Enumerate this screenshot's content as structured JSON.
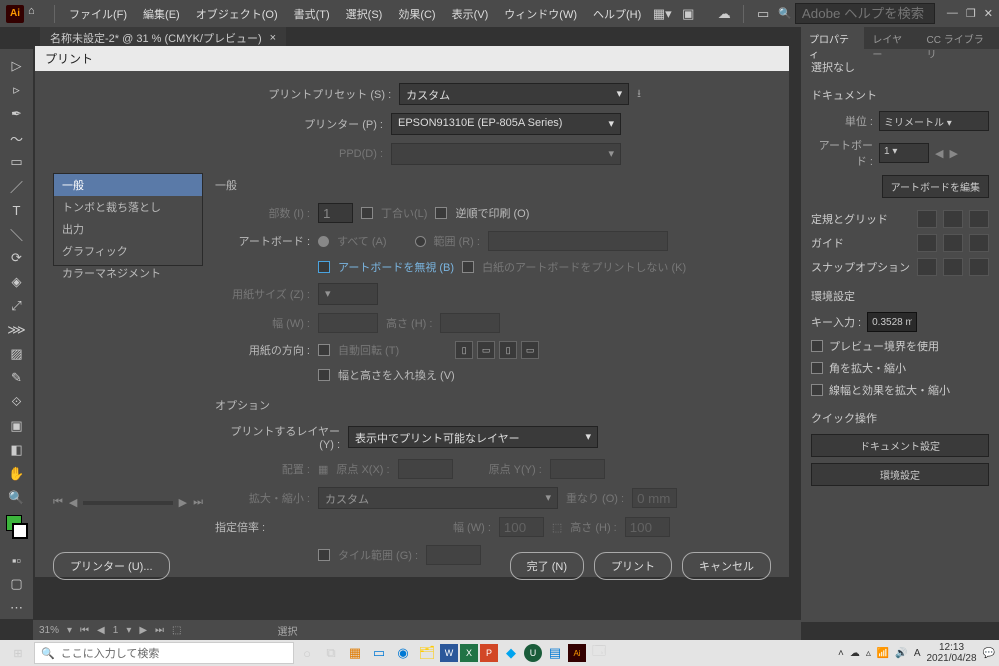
{
  "app": {
    "logo_text": "Ai",
    "menus": [
      "ファイル(F)",
      "編集(E)",
      "オブジェクト(O)",
      "書式(T)",
      "選択(S)",
      "効果(C)",
      "表示(V)",
      "ウィンドウ(W)",
      "ヘルプ(H)"
    ],
    "search_placeholder": "Adobe ヘルプを検索"
  },
  "tab": {
    "label": "名称未設定-2* @ 31 % (CMYK/プレビュー)",
    "close": "×"
  },
  "dialog": {
    "title": "プリント",
    "preset_label": "プリントプリセット (S) :",
    "preset_value": "カスタム",
    "printer_label": "プリンター (P) :",
    "printer_value": "EPSON91310E (EP-805A Series)",
    "ppd_label": "PPD(D) :",
    "categories": [
      "一般",
      "トンボと裁ち落とし",
      "出力",
      "グラフィック",
      "カラーマネジメント"
    ],
    "section": "一般",
    "copies_label": "部数 (I) :",
    "copies_value": "1",
    "collate_label": "丁合い(L)",
    "reverse_label": "逆順で印刷 (O)",
    "artboard_label": "アートボード :",
    "all_label": "すべて (A)",
    "range_label": "範囲 (R) :",
    "ignore_artboard": "アートボードを無視 (B)",
    "skip_blank": "白紙のアートボードをプリントしない (K)",
    "media_size_label": "用紙サイズ (Z) :",
    "width_label": "幅 (W) :",
    "height_label": "高さ (H) :",
    "orientation_label": "用紙の方向 :",
    "auto_rotate": "自動回転 (T)",
    "transverse": "幅と高さを入れ換え (V)",
    "options_title": "オプション",
    "layers_label": "プリントするレイヤー (Y) :",
    "layers_value": "表示中でプリント可能なレイヤー",
    "placement_label": "配置 :",
    "origin_x": "原点 X(X) :",
    "origin_y": "原点 Y(Y) :",
    "scale_label": "拡大・縮小 :",
    "scale_value": "カスタム",
    "overlap_label": "重なり (O) :",
    "overlap_value": "0 mm",
    "custom_scale": "指定倍率 :",
    "scale_w": "幅 (W) :",
    "scale_w_val": "100",
    "scale_h": "高さ (H) :",
    "scale_h_val": "100",
    "tile_range": "タイル範囲 (G) :",
    "printer_btn": "プリンター (U)...",
    "done_btn": "完了 (N)",
    "print_btn": "プリント",
    "cancel_btn": "キャンセル"
  },
  "props": {
    "tabs": [
      "プロパティ",
      "レイヤー",
      "CC ライブラリ"
    ],
    "no_selection": "選択なし",
    "doc_hdr": "ドキュメント",
    "units_label": "単位 :",
    "units_value": "ミリメートル",
    "artboard_label": "アートボード :",
    "artboard_value": "1",
    "edit_artboard": "アートボードを編集",
    "ruler_grid": "定規とグリッド",
    "guides": "ガイド",
    "snap_options": "スナップオプション",
    "prefs_hdr": "環境設定",
    "key_input": "キー入力 :",
    "key_value": "0.3528 m",
    "use_preview": "プレビュー境界を使用",
    "scale_corners": "角を拡大・縮小",
    "scale_strokes": "線幅と効果を拡大・縮小",
    "quick_hdr": "クイック操作",
    "doc_setup": "ドキュメント設定",
    "prefs_btn": "環境設定"
  },
  "status": {
    "zoom": "31%",
    "page": "1",
    "mode": "選択"
  },
  "taskbar": {
    "search_placeholder": "ここに入力して検索",
    "time": "12:13",
    "date": "2021/04/28"
  }
}
